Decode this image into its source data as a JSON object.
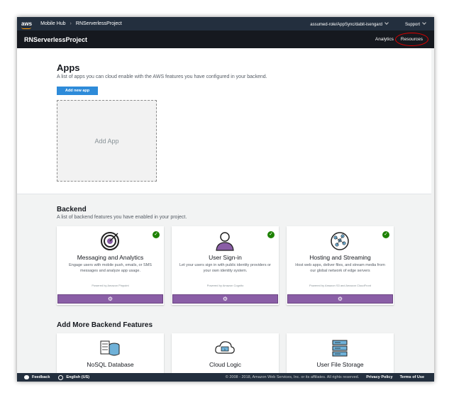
{
  "topbar": {
    "logo": "aws",
    "service": "Mobile Hub",
    "project": "RNServerlessProject",
    "role": "assumed-role/AppSync/dabit-isengard",
    "support": "Support"
  },
  "projectbar": {
    "title": "RNServerlessProject",
    "nav": [
      "Analytics",
      "Resources"
    ]
  },
  "apps": {
    "heading": "Apps",
    "description": "A list of apps you can cloud enable with the AWS features you have configured in your backend.",
    "add_button": "Add new app",
    "add_placeholder": "Add App"
  },
  "backend": {
    "heading": "Backend",
    "description": "A list of backend features you have enabled in your project.",
    "cards": [
      {
        "title": "Messaging and Analytics",
        "description": "Engage users with mobile push, emails, or SMS messages and analyze app usage.",
        "powered_by": "Powered by Amazon Pinpoint",
        "icon": "target-icon"
      },
      {
        "title": "User Sign-in",
        "description": "Let your users sign in with public identity providers or your own identity system.",
        "powered_by": "Powered by Amazon Cognito",
        "icon": "user-icon"
      },
      {
        "title": "Hosting and Streaming",
        "description": "Host web apps, deliver files, and stream media from our global network of edge servers",
        "powered_by": "Powered by Amazon S3 and Amazon CloudFront",
        "icon": "network-globe-icon"
      }
    ]
  },
  "more": {
    "heading": "Add More Backend Features",
    "cards": [
      {
        "title": "NoSQL Database",
        "icon": "database-icon"
      },
      {
        "title": "Cloud Logic",
        "icon": "cloud-icon"
      },
      {
        "title": "User File Storage",
        "icon": "file-storage-icon"
      }
    ]
  },
  "footer": {
    "feedback": "Feedback",
    "language": "English (US)",
    "copyright": "© 2008 - 2018, Amazon Web Services, Inc. or its affiliates. All rights reserved.",
    "privacy": "Privacy Policy",
    "terms": "Terms of Use"
  },
  "colors": {
    "topbar": "#232f3e",
    "projectbar": "#16191f",
    "button_blue": "#2e8bd9",
    "config_purple": "#8a5ea6",
    "check_green": "#1d8102",
    "highlight_red": "#e00000"
  }
}
